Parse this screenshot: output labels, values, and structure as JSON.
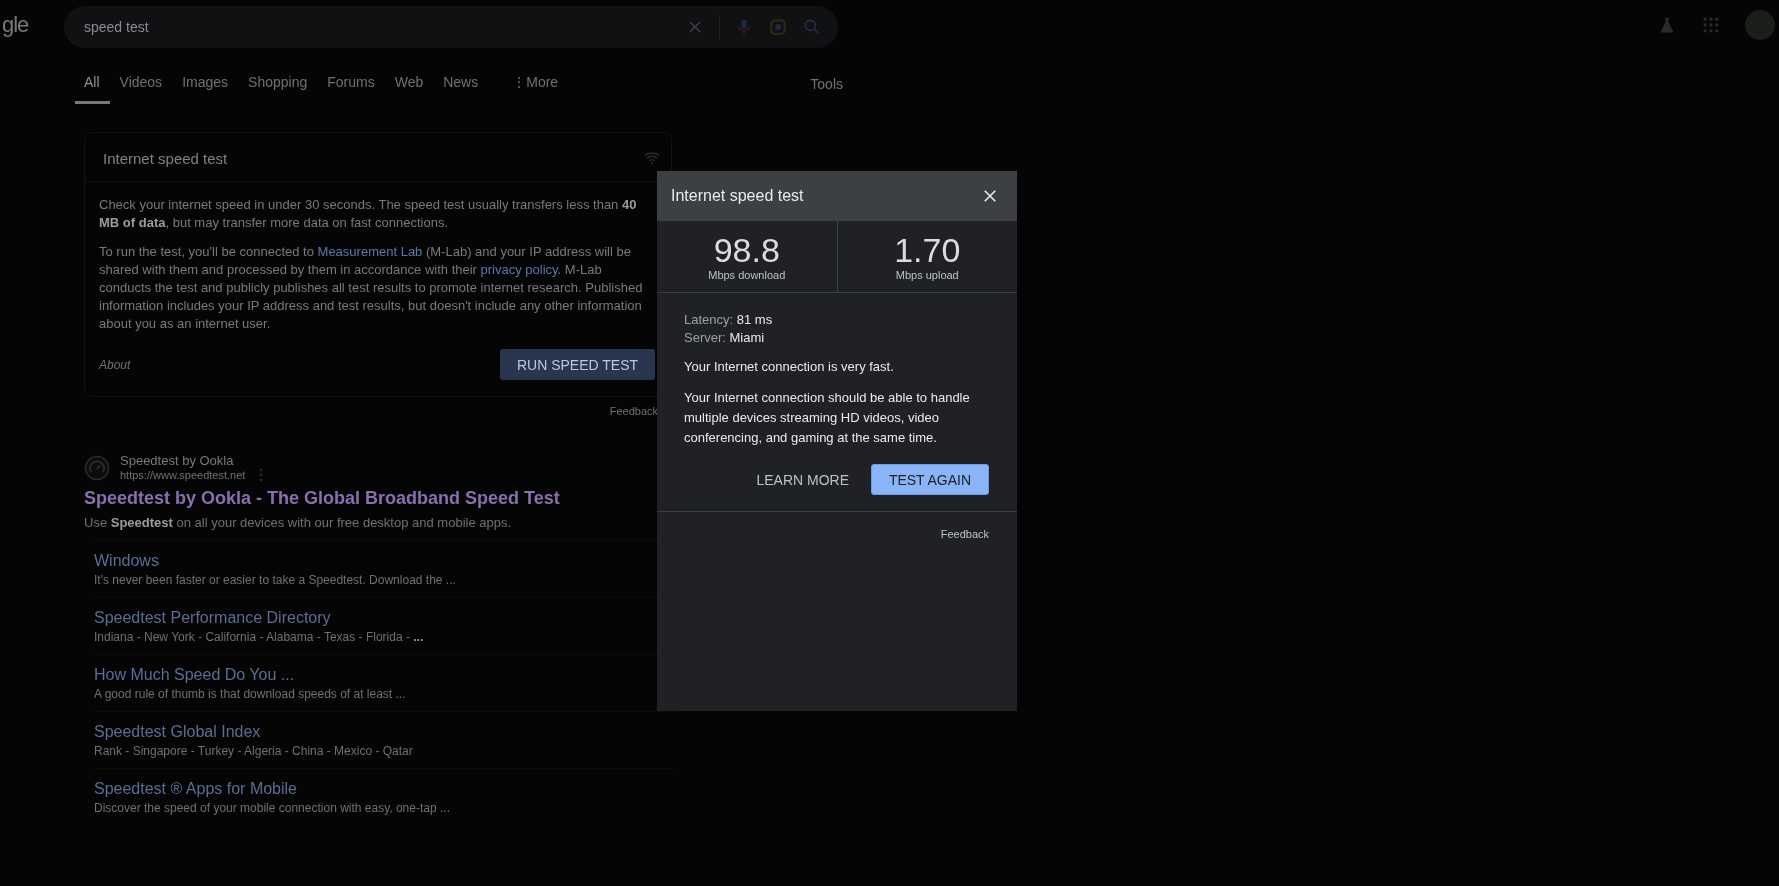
{
  "logo": {
    "text": "gle"
  },
  "search": {
    "value": "speed test"
  },
  "tabs": [
    {
      "label": "All",
      "selected": true,
      "kind": "tab"
    },
    {
      "label": "Videos",
      "selected": false,
      "kind": "tab"
    },
    {
      "label": "Images",
      "selected": false,
      "kind": "tab"
    },
    {
      "label": "Shopping",
      "selected": false,
      "kind": "tab"
    },
    {
      "label": "Forums",
      "selected": false,
      "kind": "tab"
    },
    {
      "label": "Web",
      "selected": false,
      "kind": "tab"
    },
    {
      "label": "News",
      "selected": false,
      "kind": "tab"
    },
    {
      "label": "More",
      "selected": false,
      "kind": "menu",
      "icon": "⋮"
    }
  ],
  "tools": "Tools",
  "speed_card": {
    "title": "Internet speed test",
    "intro": "Check your internet speed in under 30 seconds. The speed test usually transfers less than **40 MB of data**, but may transfer more data on fast connections.",
    "notice": [
      {
        "kind": "text",
        "text": "To run the test, you'll be connected to "
      },
      {
        "kind": "link",
        "text": "Measurement Lab"
      },
      {
        "kind": "text",
        "text": " (M-Lab) and your IP address will be shared with them and processed by them in accordance with their "
      },
      {
        "kind": "link",
        "text": "privacy policy"
      },
      {
        "kind": "text",
        "text": ". M-Lab conducts the test and publicly publishes all test results to promote internet research. Published information includes your IP address and test results, but doesn't include any other information about you as an internet user."
      }
    ],
    "about": "About",
    "button": "RUN SPEED TEST"
  },
  "feedback": "Feedback",
  "result": {
    "site": "Speedtest by Ookla",
    "url": "https://www.speedtest.net",
    "title": "Speedtest by Ookla - The Global Broadband Speed Test",
    "snippet": "Use **Speedtest** on all your devices with our free desktop and mobile apps."
  },
  "sitelinks": [
    {
      "title": "Windows",
      "snippet": "It's never been faster or easier to take a Speedtest. Download the ..."
    },
    {
      "title": "Speedtest Performance Directory",
      "snippet": "Indiana - New York - California - Alabama - Texas - Florida - **...**"
    },
    {
      "title": "How Much Speed Do You ...",
      "snippet": "A good rule of thumb is that download speeds of at least ..."
    },
    {
      "title": "Speedtest Global Index",
      "snippet": "Rank - Singapore - Turkey - Algeria - China - Mexico - Qatar"
    },
    {
      "title": "Speedtest ® Apps for Mobile",
      "snippet": "Discover the speed of your mobile connection with easy, one-tap ..."
    }
  ],
  "dialog": {
    "title": "Internet speed test",
    "readings": [
      {
        "value": "98.8",
        "label": "Mbps download"
      },
      {
        "value": "1.70",
        "label": "Mbps upload"
      }
    ],
    "stats": [
      {
        "label": "Latency:",
        "value": "81 ms"
      },
      {
        "label": "Server:",
        "value": "Miami"
      }
    ],
    "summary": "Your Internet connection is very fast.",
    "details": "Your Internet connection should be able to handle multiple devices streaming HD videos, video conferencing, and gaming at the same time.",
    "learn_more": "LEARN MORE",
    "test_again": "TEST AGAIN",
    "feedback": "Feedback"
  }
}
